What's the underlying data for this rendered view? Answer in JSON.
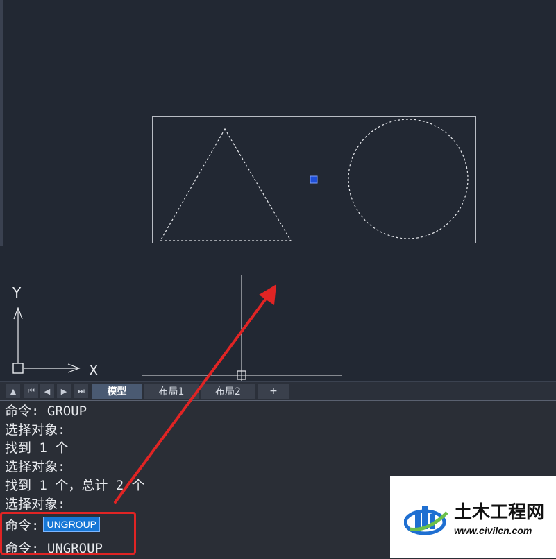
{
  "ucs": {
    "y_label": "Y",
    "x_label": "X"
  },
  "tabs": {
    "nav_buttons": [
      "▲",
      "⏮",
      "◀",
      "▶",
      "⏭"
    ],
    "items": [
      {
        "label": "模型",
        "active": true
      },
      {
        "label": "布局1",
        "active": false
      },
      {
        "label": "布局2",
        "active": false
      },
      {
        "label": "+",
        "active": false
      }
    ]
  },
  "command": {
    "history": [
      "命令: GROUP",
      "选择对象:",
      "找到 1 个",
      "选择对象:",
      "找到 1 个，总计 2 个",
      "选择对象:"
    ],
    "prompt": "命令:",
    "input_value": "UNGROUP",
    "last_line": "命令: UNGROUP"
  },
  "watermark": {
    "title": "土木工程网",
    "url": "www.civilcn.com"
  },
  "colors": {
    "background": "#222833",
    "annotation_red": "#e02424",
    "grip_blue": "#1f4fd8",
    "input_highlight": "#1677d6"
  }
}
